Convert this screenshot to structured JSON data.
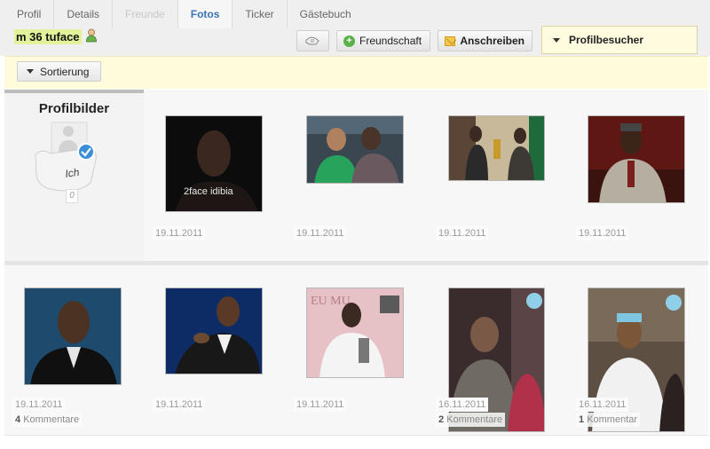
{
  "tabs": [
    {
      "label": "Profil",
      "state": "normal"
    },
    {
      "label": "Details",
      "state": "normal"
    },
    {
      "label": "Freunde",
      "state": "disabled"
    },
    {
      "label": "Fotos",
      "state": "active"
    },
    {
      "label": "Ticker",
      "state": "normal"
    },
    {
      "label": "Gästebuch",
      "state": "normal"
    }
  ],
  "user": {
    "name": "m 36 tuface",
    "status_icon": "user-online-icon"
  },
  "actions": {
    "friend_label": "Freundschaft",
    "write_label": "Anschreiben",
    "visitors_label": "Profilbesucher"
  },
  "sort": {
    "label": "Sortierung"
  },
  "profile_pictures": {
    "title": "Profilbilder",
    "card_label": "Ich",
    "count": "0"
  },
  "colors": {
    "accent": "#3a73b6",
    "highlight": "#e1f29a",
    "sortbar": "#fffbdb",
    "friend_icon": "#5cb04a"
  },
  "photos": [
    {
      "date": "19.11.2011",
      "comments_count": "",
      "comments_label": "",
      "caption": "2face idibia",
      "palette": [
        "#0d0d0d",
        "#3a2a22",
        "#8a6a55"
      ]
    },
    {
      "date": "19.11.2011",
      "comments_count": "",
      "comments_label": "",
      "caption": "",
      "palette": [
        "#2a3b2e",
        "#27a35c",
        "#d9d2c4"
      ]
    },
    {
      "date": "19.11.2011",
      "comments_count": "",
      "comments_label": "",
      "caption": "",
      "palette": [
        "#b9a98c",
        "#3a2c22",
        "#d6c9a5"
      ]
    },
    {
      "date": "19.11.2011",
      "comments_count": "",
      "comments_label": "",
      "caption": "",
      "palette": [
        "#6a1a16",
        "#b8b0a0",
        "#3b1a10"
      ]
    },
    {
      "date": "19.11.2011",
      "comments_count": "4",
      "comments_label": "Kommentare",
      "caption": "",
      "palette": [
        "#1f4b6e",
        "#111111",
        "#6b4a35"
      ]
    },
    {
      "date": "19.11.2011",
      "comments_count": "",
      "comments_label": "",
      "caption": "",
      "palette": [
        "#0f2f6a",
        "#171717",
        "#8a6040"
      ]
    },
    {
      "date": "19.11.2011",
      "comments_count": "",
      "comments_label": "",
      "caption": "",
      "palette": [
        "#e8c9cc",
        "#f1f1f1",
        "#3b2a22"
      ]
    },
    {
      "date": "16.11.2011",
      "comments_count": "2",
      "comments_label": "Kommentare",
      "caption": "",
      "palette": [
        "#3b2b2b",
        "#b2314a",
        "#7f6a5c"
      ]
    },
    {
      "date": "16.11.2011",
      "comments_count": "1",
      "comments_label": "Kommentar",
      "caption": "",
      "palette": [
        "#6b5b4c",
        "#f0f0f0",
        "#2a2220"
      ]
    }
  ]
}
